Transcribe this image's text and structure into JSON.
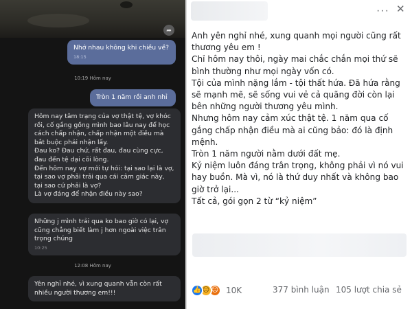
{
  "chat": {
    "messages": [
      {
        "side": "out",
        "text": "Nhớ nhau không khi chiều về?",
        "time": "18:15"
      },
      {
        "side": "out",
        "text": "Tròn 1 năm rồi anh nhỉ",
        "time": ""
      },
      {
        "side": "in",
        "text": "Hôm nay tâm trạng của vợ thật tệ, vợ khóc rồi, cố gắng gồng mình bao lâu nay để học cách chấp nhận, chấp nhận một điều mà bắt buộc phải nhận lấy.\nĐau ko? Đau chứ, rất đau, đau cùng cực, đau đến tệ dại cõi lòng.\nĐến hôm nay vợ mới tự hỏi: tại sao lại là vợ, tại sao vợ phải trải qua cái cảm giác này, tại sao cứ phải là vợ?\nLà vợ đáng để nhận điều này sao?",
        "time": ""
      },
      {
        "side": "in",
        "text": "Những j mình trải qua ko bao giờ có lại, vợ cũng chẳng biết làm j hơn ngoài việc trân trọng chúng",
        "time": "10:25"
      },
      {
        "side": "in",
        "text": "Yên nghỉ nhé, vì xung quanh vẫn còn rất nhiều người thương em!!!",
        "time": ""
      }
    ],
    "separators": [
      "10:19 Hôm nay",
      "12:08 Hôm nay"
    ],
    "share_icon": "share-arrow-icon"
  },
  "post": {
    "menu_icon": "more-horizontal-icon",
    "close_icon": "close-icon",
    "body_text": "Anh yên nghỉ nhé, xung quanh mọi người cũng rất thương yêu em !\nChỉ hôm nay thôi, ngày mai chắc chắn mọi thứ sẽ bình thường như mọi ngày vốn có.\nTội của mình nặng lắm - tội thất hứa. Đã hứa rằng sẽ mạnh mẽ, sẽ sống vui vẻ cả quãng đời còn lại bên những người thương yêu mình.\nNhưng hôm nay cảm xúc thật tệ. 1 năm qua cố gắng chấp nhận điều mà ai cũng bảo: đó là định mệnh.\nTròn 1 năm người nằm dưới đất mẹ.\nKỷ niệm luôn đáng trân trọng, không phải vì nó vui hay buồn. Mà vì, nó là thứ duy nhất và không bao giờ trở lại...\nTất cả, gói gọn 2 từ “kỷ niệm”",
    "reactions": {
      "icons": [
        "like-icon",
        "sad-icon",
        "angry-icon"
      ],
      "count": "10K"
    },
    "comments": "377 bình luận",
    "shares": "105 lượt chia sẻ",
    "colors": {
      "like": "#1877f2",
      "sad": "#f7b125",
      "angry": "#e9710f",
      "text": "#1c1e21",
      "meta": "#65676b"
    }
  }
}
